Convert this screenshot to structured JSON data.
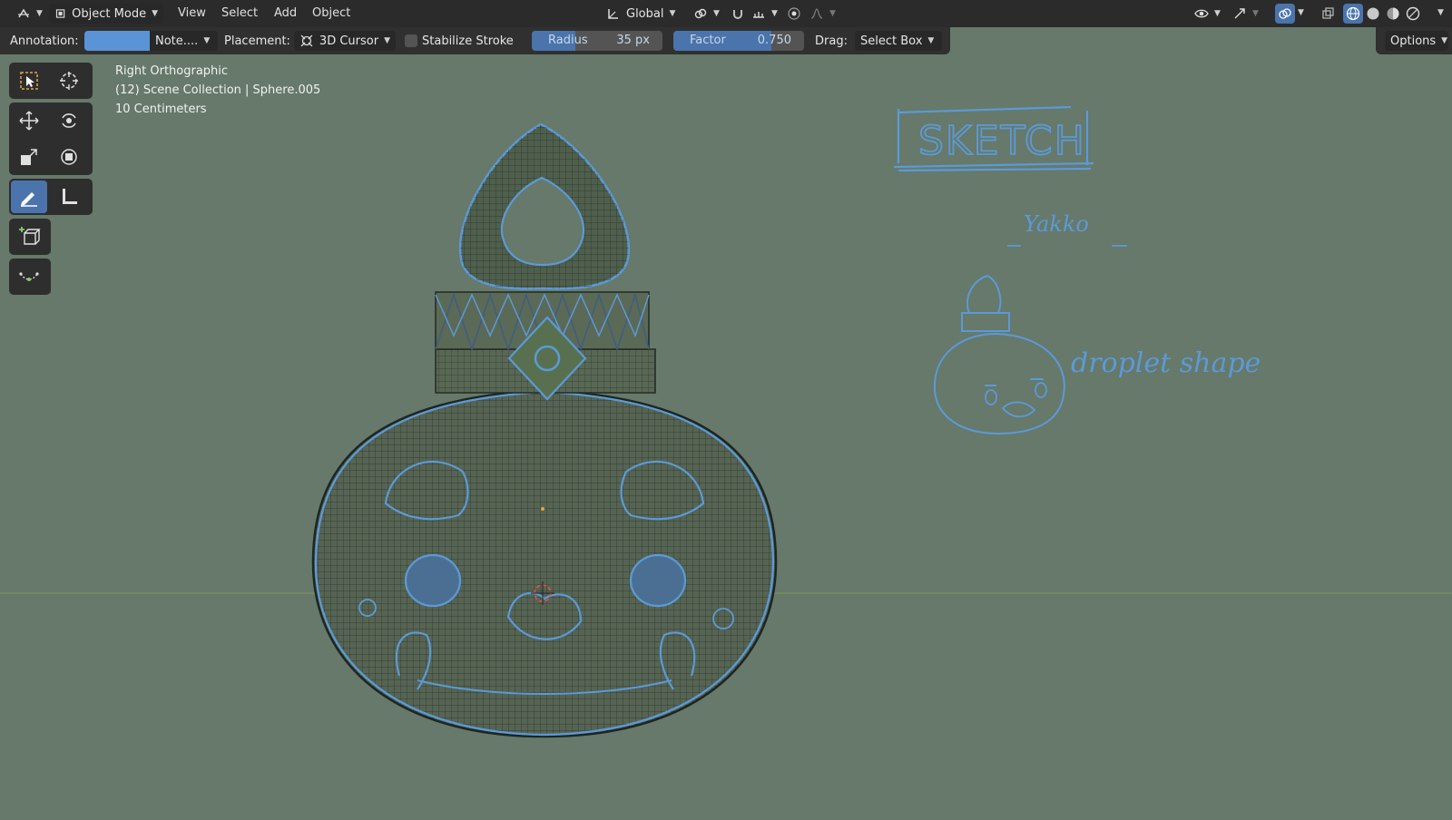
{
  "header": {
    "mode_label": "Object Mode",
    "menu": [
      "View",
      "Select",
      "Add",
      "Object"
    ],
    "transform_orientation": "Global",
    "options_label": "Options"
  },
  "toolbar": {
    "annotation_label": "Annotation:",
    "annotation_color": "#5b94d6",
    "note_label": "Note....",
    "placement_label": "Placement:",
    "placement_value": "3D Cursor",
    "stabilize_label": "Stabilize Stroke",
    "stabilize_checked": false,
    "radius_label": "Radius",
    "radius_value": "35 px",
    "factor_label": "Factor",
    "factor_value": "0.750",
    "factor_fraction": 0.75,
    "drag_label": "Drag:",
    "drag_value": "Select Box"
  },
  "viewport": {
    "view_name": "Right Orthographic",
    "collection_info": "(12) Scene Collection | Sphere.005",
    "scale_info": "10 Centimeters",
    "background_color": "#66796a",
    "annotation_stroke_color": "#5b9ad8"
  },
  "sketch_notes": {
    "title": "SKETCH",
    "name": "Yakko",
    "caption": "droplet shape"
  },
  "tools": [
    {
      "name": "select-box-tool",
      "icon": "select-box-icon"
    },
    {
      "name": "cursor-tool",
      "icon": "cursor-icon"
    },
    {
      "name": "move-tool",
      "icon": "move-icon"
    },
    {
      "name": "rotate-tool",
      "icon": "rotate-icon"
    },
    {
      "name": "scale-tool",
      "icon": "scale-icon"
    },
    {
      "name": "transform-tool",
      "icon": "transform-icon"
    },
    {
      "name": "annotate-tool",
      "icon": "pencil-icon",
      "active": true
    },
    {
      "name": "measure-tool",
      "icon": "ruler-icon"
    },
    {
      "name": "add-cube-tool",
      "icon": "add-cube-icon"
    },
    {
      "name": "annotate-line-tool",
      "icon": "curve-icon"
    }
  ]
}
